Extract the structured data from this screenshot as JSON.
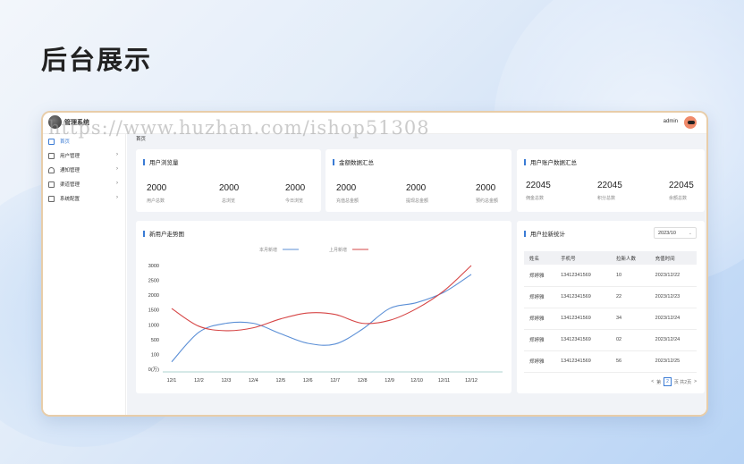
{
  "page_heading": "后台展示",
  "watermark": "https://www.huzhan.com/ishop51308",
  "app": {
    "title": "管理系统",
    "user": "admin"
  },
  "breadcrumb": "首页",
  "sidebar": {
    "items": [
      {
        "label": "首页",
        "icon": "home-icon",
        "active": true
      },
      {
        "label": "用户管理",
        "icon": "user-icon",
        "chevron": true
      },
      {
        "label": "通知管理",
        "icon": "bell-icon",
        "chevron": true
      },
      {
        "label": "渠道管理",
        "icon": "channel-icon",
        "chevron": true
      },
      {
        "label": "系统配置",
        "icon": "settings-icon",
        "chevron": true
      }
    ]
  },
  "cards": {
    "browse": {
      "title": "用户浏览量",
      "stats": [
        {
          "value": "2000",
          "label": "用户总数"
        },
        {
          "value": "2000",
          "label": "总浏览"
        },
        {
          "value": "2000",
          "label": "今日浏览"
        }
      ]
    },
    "amount": {
      "title": "金额数据汇总",
      "stats": [
        {
          "value": "2000",
          "label": "充值总金额"
        },
        {
          "value": "2000",
          "label": "提现总金额"
        },
        {
          "value": "2000",
          "label": "预约总金额"
        }
      ]
    },
    "account": {
      "title": "用户账户数据汇总",
      "stats": [
        {
          "value": "22045",
          "label": "佣金总数"
        },
        {
          "value": "22045",
          "label": "积分总数"
        },
        {
          "value": "22045",
          "label": "余额总数"
        }
      ]
    }
  },
  "trend": {
    "title": "新用户走势图"
  },
  "invite": {
    "title": "用户拉新统计",
    "select_value": "2023/10",
    "columns": [
      "姓名",
      "手机号",
      "拉新人数",
      "充值时间"
    ],
    "rows": [
      [
        "郑婷雅",
        "13412341569",
        "10",
        "2023/12/22"
      ],
      [
        "郑婷雅",
        "13412341569",
        "22",
        "2023/12/23"
      ],
      [
        "郑婷雅",
        "13412341569",
        "34",
        "2023/12/24"
      ],
      [
        "郑婷雅",
        "13412341569",
        "02",
        "2023/12/24"
      ],
      [
        "郑婷雅",
        "13412341569",
        "56",
        "2023/12/25"
      ]
    ],
    "pager": {
      "prev": "<",
      "label_a": "第",
      "page": "2",
      "label_b": "页 共2页",
      "next": ">"
    }
  },
  "chart_data": {
    "type": "line",
    "title": "",
    "x": [
      "12/1",
      "12/2",
      "12/3",
      "12/4",
      "12/5",
      "12/6",
      "12/7",
      "12/8",
      "12/9",
      "12/10",
      "12/11",
      "12/12"
    ],
    "y_ticks": [
      "3000",
      "2500",
      "2000",
      "1500",
      "1000",
      "500",
      "100",
      "0(万)"
    ],
    "series": [
      {
        "name": "本月新增",
        "color": "#5b8fd6",
        "values": [
          50,
          750,
          1050,
          1050,
          700,
          400,
          380,
          850,
          1550,
          1750,
          2100,
          2700
        ]
      },
      {
        "name": "上月新增",
        "color": "#d64545",
        "values": [
          1550,
          950,
          800,
          900,
          1200,
          1400,
          1350,
          1050,
          1150,
          1550,
          2150,
          3000
        ]
      }
    ],
    "legend_position": "top"
  }
}
